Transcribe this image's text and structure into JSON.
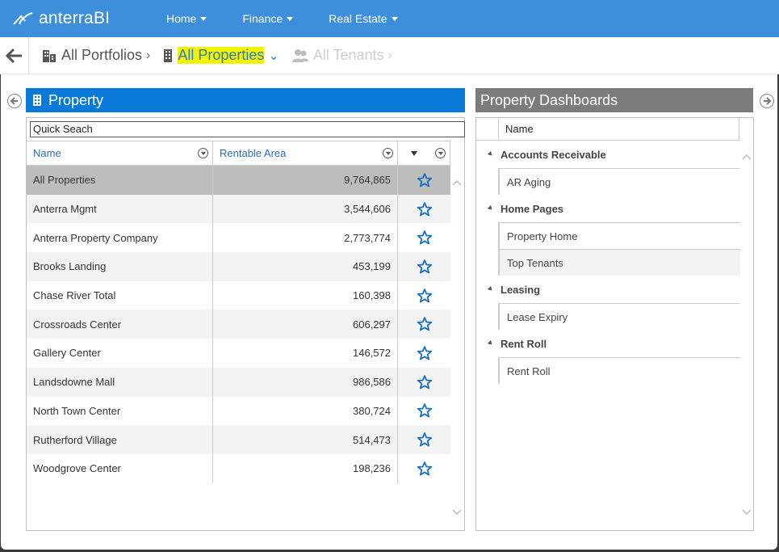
{
  "app": {
    "brand": "anterraBI"
  },
  "nav": {
    "items": [
      {
        "label": "Home"
      },
      {
        "label": "Finance"
      },
      {
        "label": "Real Estate"
      }
    ]
  },
  "breadcrumb": {
    "portfolios": "All Portfolios",
    "properties": "All Properties",
    "tenants": "All Tenants"
  },
  "property_panel": {
    "title": "Property",
    "search_placeholder": "Quick Seach",
    "columns": {
      "name": "Name",
      "area": "Rentable Area"
    },
    "rows": [
      {
        "name": "All Properties",
        "area": "9,764,865"
      },
      {
        "name": "Anterra Mgmt",
        "area": "3,544,606"
      },
      {
        "name": "Anterra Property Company",
        "area": "2,773,774"
      },
      {
        "name": "Brooks Landing",
        "area": "453,199"
      },
      {
        "name": "Chase River Total",
        "area": "160,398"
      },
      {
        "name": "Crossroads Center",
        "area": "606,297"
      },
      {
        "name": "Gallery Center",
        "area": "146,572"
      },
      {
        "name": "Landsdowne Mall",
        "area": "986,586"
      },
      {
        "name": "North Town Center",
        "area": "380,724"
      },
      {
        "name": "Rutherford Village",
        "area": "514,473"
      },
      {
        "name": "Woodgrove Center",
        "area": "198,236"
      }
    ]
  },
  "dashboard_panel": {
    "title": "Property Dashboards",
    "column": "Name",
    "groups": [
      {
        "label": "Accounts Receivable",
        "items": [
          "AR Aging"
        ]
      },
      {
        "label": "Home Pages",
        "items": [
          "Property Home",
          "Top Tenants"
        ]
      },
      {
        "label": "Leasing",
        "items": [
          "Lease Expiry"
        ]
      },
      {
        "label": "Rent Roll",
        "items": [
          "Rent Roll"
        ]
      }
    ]
  },
  "colors": {
    "appbar": "#3d8fdc",
    "property_header": "#0a7ad8",
    "dashboard_header": "#7c7c7c",
    "star": "#1a6fc0",
    "highlight": "#f3f300"
  }
}
